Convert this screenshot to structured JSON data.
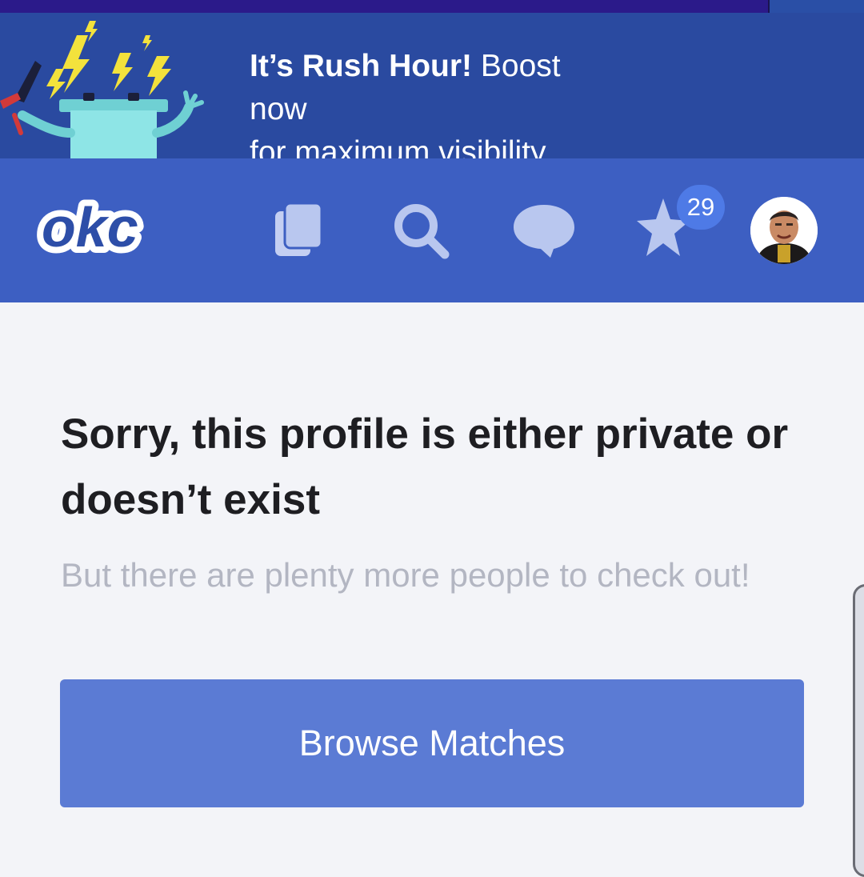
{
  "promo": {
    "bold_text": "It’s Rush Hour!",
    "line1_rest": " Boost",
    "line2": "now",
    "line3": "for maximum visibility."
  },
  "nav": {
    "logo_text": "okc",
    "items": [
      {
        "icon": "cards-icon"
      },
      {
        "icon": "search-icon"
      },
      {
        "icon": "chat-bubble-icon"
      },
      {
        "icon": "star-icon",
        "badge": "29"
      },
      {
        "icon": "profile-avatar"
      }
    ]
  },
  "main": {
    "heading": "Sorry, this profile is either private or doesn’t exist",
    "subtext": "But there are plenty more people to check out!",
    "button_label": "Browse Matches"
  },
  "colors": {
    "promo_bg": "#2a4aa0",
    "nav_bg": "#3d5fc2",
    "nav_icon": "#b9c7ef",
    "badge": "#4e7ae6",
    "button": "#5b7bd4",
    "page_bg": "#f3f4f8"
  }
}
